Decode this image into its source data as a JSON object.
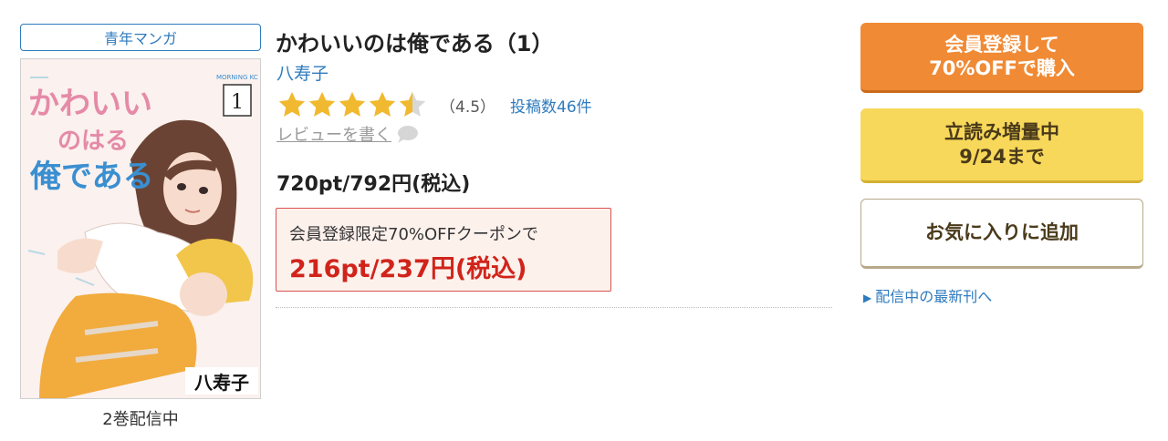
{
  "genre": "青年マンガ",
  "volumes_status": "2巻配信中",
  "cover": {
    "title_line1": "かわいい",
    "title_line2": "のはる",
    "title_line3": "俺である",
    "volume_number": "1",
    "label": "MORNING KC",
    "author_name": "八寿子"
  },
  "book": {
    "title": "かわいいのは俺である（1）",
    "author": "八寿子",
    "rating": 4.5,
    "rating_text": "（4.5）",
    "review_count": "投稿数46件",
    "write_review": "レビューを書く",
    "price": "720pt/792円(税込)"
  },
  "coupon": {
    "text": "会員登録限定70%OFFクーポンで",
    "price": "216pt/237円(税込)"
  },
  "buttons": {
    "signup_line1": "会員登録して",
    "signup_line2": "70%OFFで購入",
    "trial_line1": "立読み増量中",
    "trial_line2": "9/24まで",
    "favorite": "お気に入りに追加"
  },
  "latest_link": "配信中の最新刊へ",
  "colors": {
    "link_blue": "#2f7bbd",
    "signup_orange": "#f08a35",
    "trial_yellow": "#f7d85a",
    "coupon_red": "#d0241b",
    "star_gold": "#f0b92f"
  }
}
